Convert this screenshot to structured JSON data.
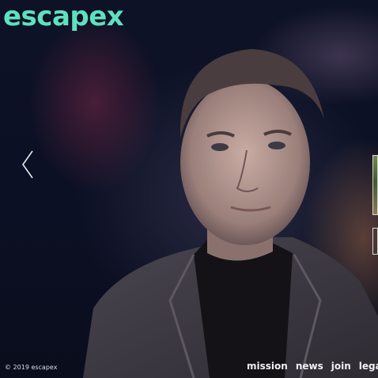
{
  "brand": {
    "logo_text": "escapex",
    "accent_color": "#5fe0c0"
  },
  "hero": {
    "image": "portrait-photo",
    "prev_icon": "chevron-left-icon"
  },
  "footer": {
    "copyright": "© 2019 escapex"
  },
  "nav": {
    "items": [
      {
        "label": "mission"
      },
      {
        "label": "news"
      },
      {
        "label": "join"
      },
      {
        "label": "legal"
      }
    ]
  }
}
